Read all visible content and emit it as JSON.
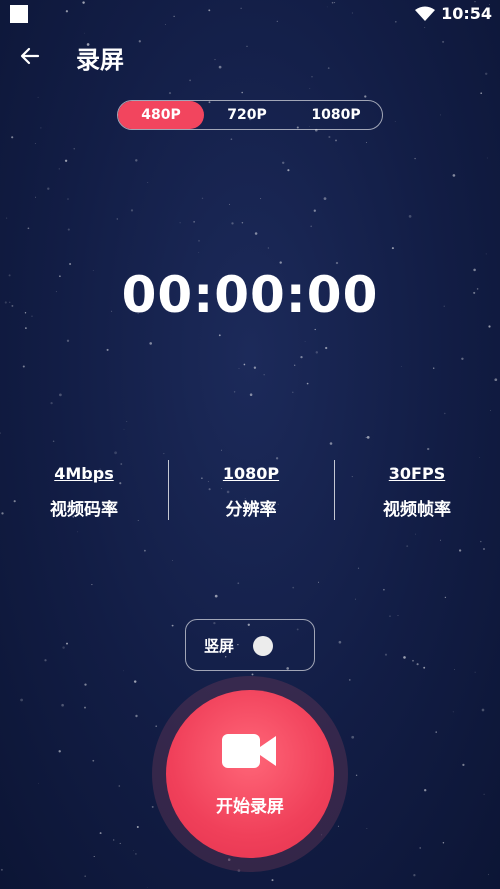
{
  "status_bar": {
    "time": "10:54"
  },
  "header": {
    "title": "录屏"
  },
  "resolution_tabs": [
    {
      "label": "480P",
      "active": true
    },
    {
      "label": "720P",
      "active": false
    },
    {
      "label": "1080P",
      "active": false
    }
  ],
  "timer": "00:00:00",
  "stats": [
    {
      "value": "4Mbps",
      "label": "视频码率"
    },
    {
      "value": "1080P",
      "label": "分辨率"
    },
    {
      "value": "30FPS",
      "label": "视频帧率"
    }
  ],
  "portrait": {
    "label": "竖屏",
    "enabled": false
  },
  "record_button": {
    "label": "开始录屏"
  },
  "colors": {
    "accent": "#f2455e",
    "background": "#121d45"
  },
  "icons": {
    "back": "arrow-left-icon",
    "camera": "video-camera-icon",
    "wifi": "wifi-icon"
  }
}
